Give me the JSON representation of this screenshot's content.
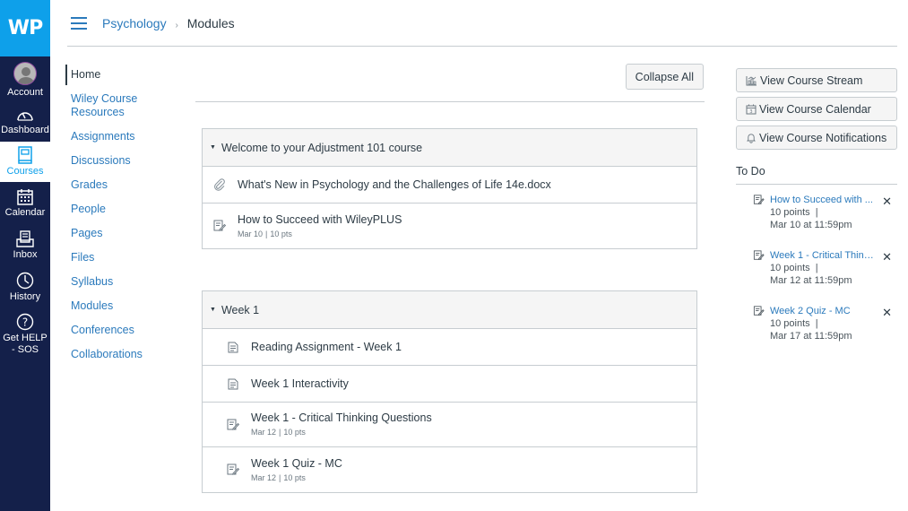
{
  "global_nav": {
    "logo": "WP",
    "items": [
      {
        "label": "Account",
        "icon": "account-avatar-icon"
      },
      {
        "label": "Dashboard",
        "icon": "dashboard-speedometer-icon"
      },
      {
        "label": "Courses",
        "icon": "courses-book-icon",
        "active": true
      },
      {
        "label": "Calendar",
        "icon": "calendar-icon"
      },
      {
        "label": "Inbox",
        "icon": "inbox-icon"
      },
      {
        "label": "History",
        "icon": "clock-icon"
      },
      {
        "label": "Get HELP - SOS",
        "icon": "help-question-icon"
      }
    ]
  },
  "header": {
    "menu_icon": "hamburger-icon",
    "breadcrumb": {
      "course": "Psychology",
      "separator": "›",
      "current": "Modules"
    }
  },
  "course_nav": {
    "items": [
      {
        "label": "Home",
        "active": true
      },
      {
        "label": "Wiley Course Resources"
      },
      {
        "label": "Assignments"
      },
      {
        "label": "Discussions"
      },
      {
        "label": "Grades"
      },
      {
        "label": "People"
      },
      {
        "label": "Pages"
      },
      {
        "label": "Files"
      },
      {
        "label": "Syllabus"
      },
      {
        "label": "Modules"
      },
      {
        "label": "Conferences"
      },
      {
        "label": "Collaborations"
      }
    ]
  },
  "main": {
    "collapse_all_label": "Collapse All",
    "modules": [
      {
        "title": "Welcome to your Adjustment 101 course",
        "expand_icon": "caret-down-icon",
        "items": [
          {
            "type": "attachment",
            "icon": "paperclip-icon",
            "title": "What's New in Psychology and the Challenges of Life 14e.docx"
          },
          {
            "type": "assignment",
            "icon": "assignment-icon",
            "title": "How to Succeed with WileyPLUS",
            "date": "Mar 10",
            "sep": "|",
            "points": "10 pts"
          }
        ]
      },
      {
        "title": "Week 1",
        "expand_icon": "caret-down-icon",
        "items": [
          {
            "type": "page",
            "icon": "page-icon",
            "title": "Reading Assignment - Week 1"
          },
          {
            "type": "page",
            "icon": "page-icon",
            "title": "Week 1 Interactivity"
          },
          {
            "type": "assignment",
            "icon": "assignment-icon",
            "title": "Week 1 - Critical Thinking Questions",
            "date": "Mar 12",
            "sep": "|",
            "points": "10 pts"
          },
          {
            "type": "assignment",
            "icon": "assignment-icon",
            "title": "Week 1 Quiz - MC",
            "date": "Mar 12",
            "sep": "|",
            "points": "10 pts"
          }
        ]
      }
    ]
  },
  "sidebar": {
    "buttons": [
      {
        "label": "View Course Stream",
        "icon": "stream-chart-icon"
      },
      {
        "label": "View Course Calendar",
        "icon": "calendar-icon"
      },
      {
        "label": "View Course Notifications",
        "icon": "bell-icon"
      }
    ],
    "todo_title": "To Do",
    "todo": [
      {
        "title": "How to Succeed with ...",
        "points": "10 points",
        "sep": "|",
        "due": "Mar 10 at 11:59pm"
      },
      {
        "title": "Week 1 - Critical Think...",
        "points": "10 points",
        "sep": "|",
        "due": "Mar 12 at 11:59pm"
      },
      {
        "title": "Week 2 Quiz - MC",
        "points": "10 points",
        "sep": "|",
        "due": "Mar 17 at 11:59pm"
      }
    ],
    "dismiss_glyph": "✕"
  },
  "colors": {
    "nav_bg": "#14204a",
    "logo_bg": "#0ea0ea",
    "link": "#2b7abc",
    "text": "#2d3b45",
    "border": "#c7cdd1",
    "module_header_bg": "#f5f5f5"
  }
}
